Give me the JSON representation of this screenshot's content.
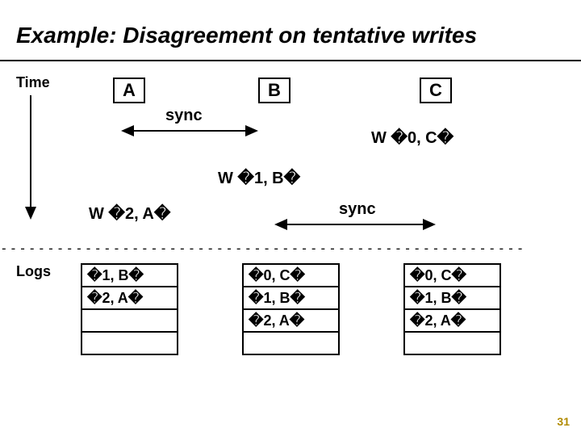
{
  "title": "Example: Disagreement on tentative writes",
  "labels": {
    "time": "Time",
    "logs": "Logs",
    "sync1": "sync",
    "sync2": "sync"
  },
  "nodes": {
    "a": "A",
    "b": "B",
    "c": "C"
  },
  "writes": {
    "w0c": "W �0, C�",
    "w1b": "W �1, B�",
    "w2a": "W �2, A�"
  },
  "logs": {
    "a": [
      "�1, B�",
      "�2, A�",
      "",
      ""
    ],
    "b": [
      "�0, C�",
      "�1, B�",
      "�2, A�",
      ""
    ],
    "c": [
      "�0, C�",
      "�1, B�",
      "�2, A�",
      ""
    ]
  },
  "divider": "--------------------------------------------------------",
  "slide_number": "31"
}
